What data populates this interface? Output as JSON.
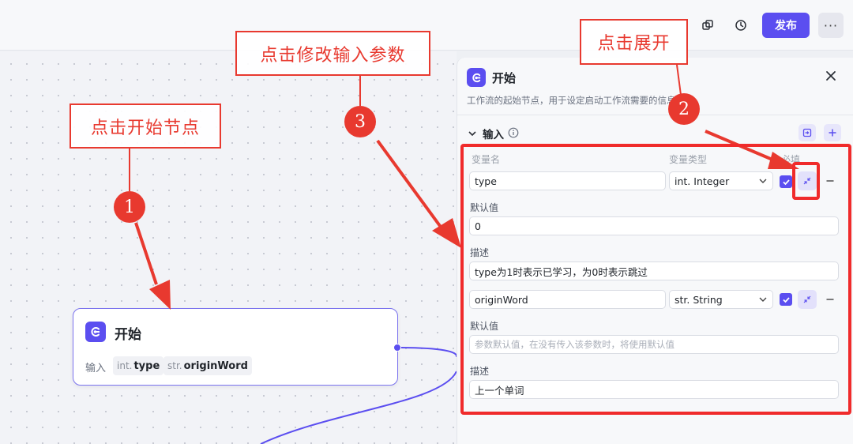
{
  "toolbar": {
    "copy_icon": "copy-icon",
    "history_icon": "history-icon",
    "publish_label": "发布",
    "more_label": "···"
  },
  "canvas": {
    "start_node": {
      "title": "开始",
      "input_label": "输入",
      "tags": [
        {
          "type": "int.",
          "name": "type"
        },
        {
          "type": "str.",
          "name": "originWord"
        }
      ]
    }
  },
  "panel": {
    "title": "开始",
    "description": "工作流的起始节点，用于设定启动工作流需要的信息",
    "section_title": "输入",
    "columns": {
      "name": "变量名",
      "type": "变量类型",
      "required": "必填"
    },
    "params": [
      {
        "name": "type",
        "type_prefix": "int.",
        "type_name": "Integer",
        "required": true,
        "default_label": "默认值",
        "default_value": "0",
        "desc_label": "描述",
        "desc_value": "type为1时表示已学习，为0时表示跳过"
      },
      {
        "name": "originWord",
        "type_prefix": "str.",
        "type_name": "String",
        "required": true,
        "default_label": "默认值",
        "default_placeholder": "参数默认值，在没有传入该参数时，将使用默认值",
        "desc_label": "描述",
        "desc_value": "上一个单词"
      }
    ]
  },
  "annotations": {
    "step1_label": "点击开始节点",
    "step2_label": "点击展开",
    "step3_label": "点击修改输入参数",
    "step1_num": "1",
    "step2_num": "2",
    "step3_num": "3",
    "color": "#e8392f"
  },
  "colors": {
    "accent": "#5b4ef0",
    "annotation_red": "#e8392f"
  }
}
